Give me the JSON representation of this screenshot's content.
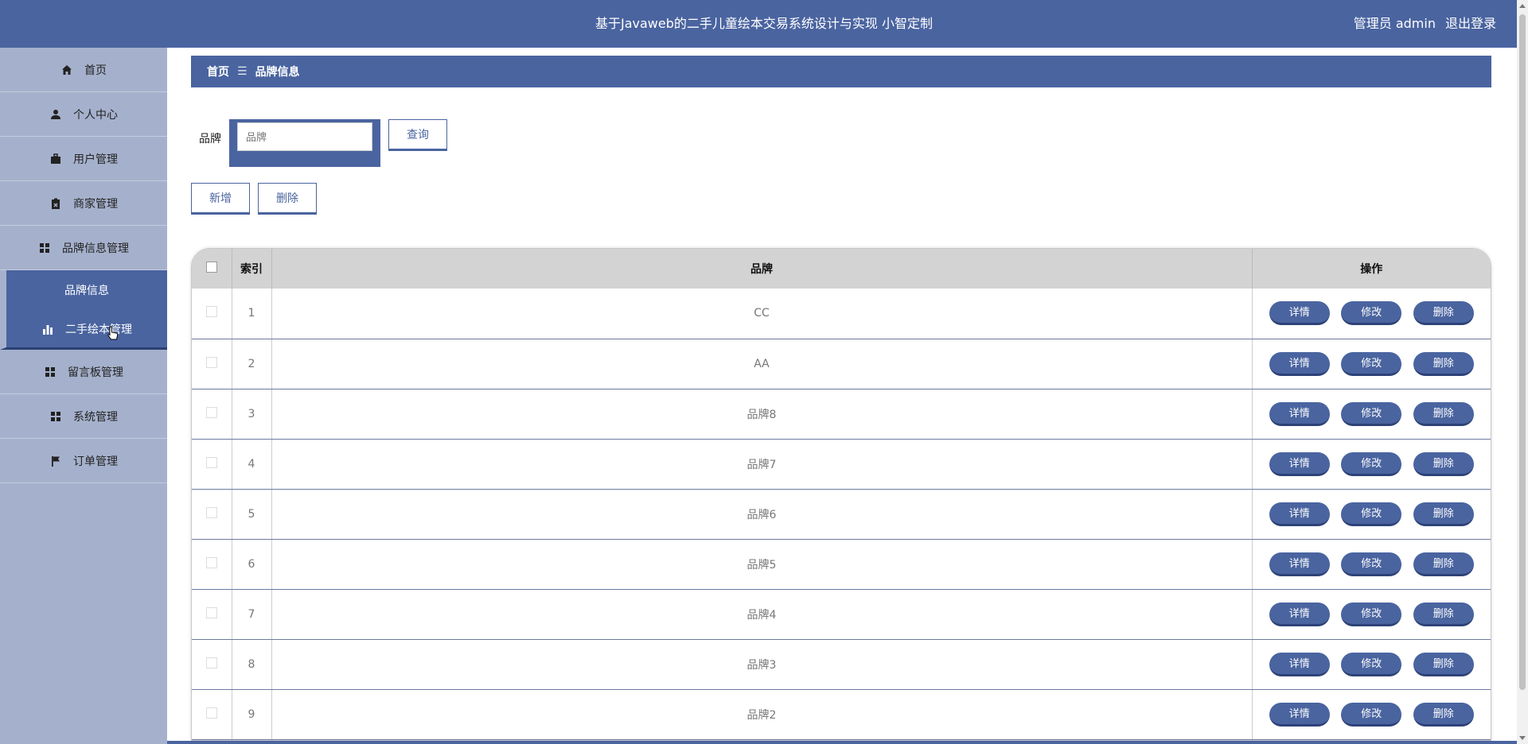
{
  "header": {
    "title": "基于Javaweb的二手儿童绘本交易系统设计与实现 小智定制",
    "user_label": "管理员 admin",
    "logout": "退出登录"
  },
  "sidebar": {
    "items": [
      {
        "label": "首页",
        "icon": "home-icon"
      },
      {
        "label": "个人中心",
        "icon": "user-icon"
      },
      {
        "label": "用户管理",
        "icon": "briefcase-icon"
      },
      {
        "label": "商家管理",
        "icon": "clipboard-icon"
      },
      {
        "label": "品牌信息管理",
        "icon": "grid-icon"
      },
      {
        "label": "品牌信息",
        "icon": ""
      },
      {
        "label": "二手绘本管理",
        "icon": "bar-chart-icon"
      },
      {
        "label": "留言板管理",
        "icon": "grid-icon"
      },
      {
        "label": "系统管理",
        "icon": "grid-icon"
      },
      {
        "label": "订单管理",
        "icon": "flag-icon"
      }
    ]
  },
  "breadcrumb": {
    "home": "首页",
    "separator": "☰",
    "current": "品牌信息"
  },
  "search": {
    "label": "品牌",
    "placeholder": "品牌",
    "query_button": "查询"
  },
  "actions": {
    "add": "新增",
    "delete": "删除"
  },
  "table": {
    "headers": [
      "",
      "索引",
      "品牌",
      "操作"
    ],
    "rows": [
      {
        "index": "1",
        "brand": "CC"
      },
      {
        "index": "2",
        "brand": "AA"
      },
      {
        "index": "3",
        "brand": "品牌8"
      },
      {
        "index": "4",
        "brand": "品牌7"
      },
      {
        "index": "5",
        "brand": "品牌6"
      },
      {
        "index": "6",
        "brand": "品牌5"
      },
      {
        "index": "7",
        "brand": "品牌4"
      },
      {
        "index": "8",
        "brand": "品牌3"
      },
      {
        "index": "9",
        "brand": "品牌2"
      }
    ],
    "row_buttons": {
      "detail": "详情",
      "edit": "修改",
      "delete": "删除"
    }
  },
  "colors": {
    "primary": "#4a64a0",
    "sidebar": "#a5b1cc",
    "table_header": "#d3d3d3"
  }
}
